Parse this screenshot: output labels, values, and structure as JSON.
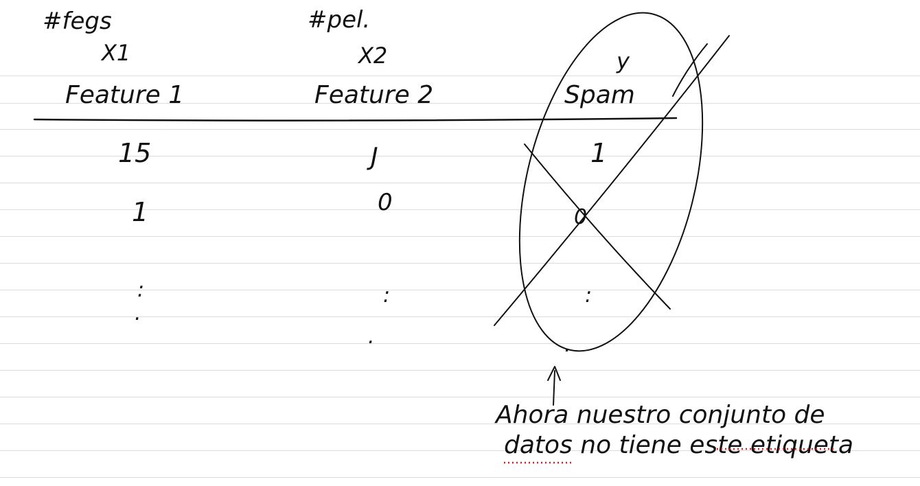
{
  "page": {
    "background": "#ffffff",
    "ruled_line_color": "#dcdcdc",
    "ink_color": "#111111",
    "annotation_color": "#d62020"
  },
  "table": {
    "columns": [
      {
        "tag": "#fegs",
        "var": "X1",
        "feature": "Feature 1",
        "values": [
          "15",
          "1",
          ":",
          "."
        ]
      },
      {
        "tag": "#pel.",
        "var": "X2",
        "feature": "Feature 2",
        "values": [
          "J",
          "0",
          ":",
          "."
        ]
      },
      {
        "tag": "",
        "var": "y",
        "feature": "Spam",
        "values": [
          "1",
          "0",
          ":",
          "."
        ]
      }
    ]
  },
  "note": {
    "line1": "Ahora nuestro conjunto de",
    "line2": "datos no tiene este etiqueta"
  }
}
